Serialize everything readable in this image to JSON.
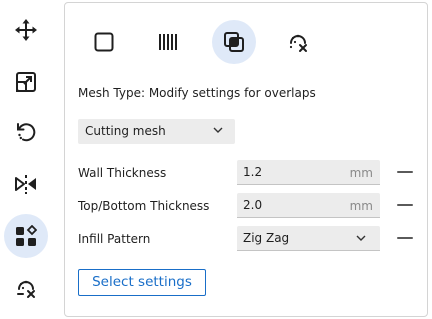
{
  "toolbar": {
    "tools": [
      {
        "icon": "move-icon",
        "active": false
      },
      {
        "icon": "scale-icon",
        "active": false
      },
      {
        "icon": "rotate-icon",
        "active": false
      },
      {
        "icon": "mirror-icon",
        "active": false
      },
      {
        "icon": "per-model-settings-icon",
        "active": true
      },
      {
        "icon": "support-blocker-icon",
        "active": false
      }
    ]
  },
  "panel": {
    "mesh_modes": [
      {
        "icon": "normal-model-icon",
        "active": false
      },
      {
        "icon": "print-as-support-icon",
        "active": false
      },
      {
        "icon": "modify-overlaps-icon",
        "active": true
      },
      {
        "icon": "dont-support-overlaps-icon",
        "active": false
      }
    ],
    "mesh_type_label": "Mesh Type: Modify settings for overlaps",
    "overlap_mode": "Cutting mesh",
    "settings": [
      {
        "label": "Wall Thickness",
        "value": "1.2",
        "unit": "mm"
      },
      {
        "label": "Top/Bottom Thickness",
        "value": "2.0",
        "unit": "mm"
      },
      {
        "label": "Infill Pattern",
        "value": "Zig Zag"
      }
    ],
    "select_settings_label": "Select settings"
  },
  "colors": {
    "accent": "#196ec8",
    "active_bg": "#dfe9f8",
    "field_bg": "#ececec",
    "border": "#d4d4d4"
  }
}
